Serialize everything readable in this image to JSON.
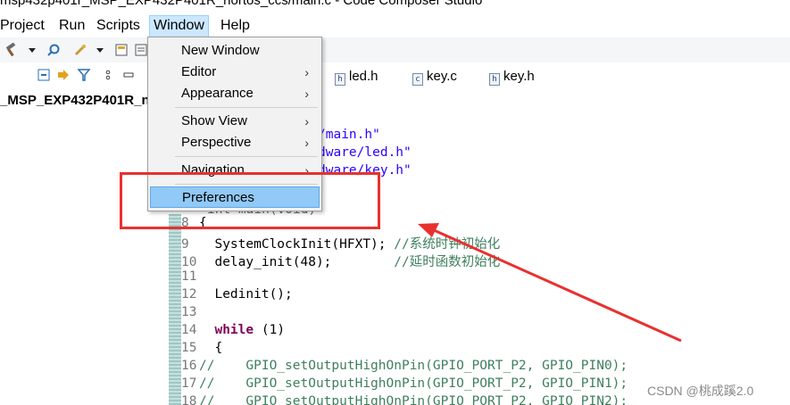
{
  "window": {
    "title": "msp432p401r_MSP_EXP432P401R_nortos_ccs/main.c - Code Composer Studio"
  },
  "menubar": {
    "items": [
      "Project",
      "Run",
      "Scripts",
      "Window",
      "Help"
    ],
    "active": "Window"
  },
  "window_menu": {
    "items": [
      {
        "label": "New Window",
        "submenu": false
      },
      {
        "label": "Editor",
        "submenu": true
      },
      {
        "label": "Appearance",
        "submenu": true
      },
      {
        "label": "Show View",
        "submenu": true
      },
      {
        "label": "Perspective",
        "submenu": true
      },
      {
        "label": "Navigation",
        "submenu": true
      },
      {
        "label": "Preferences",
        "submenu": false,
        "highlighted": true
      }
    ],
    "arrow_glyph": "›"
  },
  "editor_tabs": [
    {
      "label": "led.h",
      "icon": "h-file-icon",
      "glyph": "h"
    },
    {
      "label": "key.c",
      "icon": "c-file-icon",
      "glyph": "c"
    },
    {
      "label": "key.h",
      "icon": "h-file-icon",
      "glyph": "h"
    }
  ],
  "project_explorer": {
    "label": "_MSP_EXP432P401R_n"
  },
  "code": {
    "includes": [
      "/main.h\"",
      "dware/led.h\"",
      "dware/key.h\""
    ],
    "lines": [
      {
        "n": "8",
        "text": "{"
      },
      {
        "n": "9",
        "text": "  SystemClockInit(HFXT); ",
        "comment": "//系统时钟初始化"
      },
      {
        "n": "10",
        "text": "  delay_init(48);        ",
        "comment": "//延时函数初始化"
      },
      {
        "n": "11",
        "text": ""
      },
      {
        "n": "12",
        "text": "  Ledinit();"
      },
      {
        "n": "13",
        "text": ""
      },
      {
        "n": "14",
        "text": "  ",
        "keyword": "while",
        "after": " (1)"
      },
      {
        "n": "15",
        "text": "  {"
      },
      {
        "n": "16",
        "comment": "//    GPIO_setOutputHighOnPin(GPIO_PORT_P2, GPIO_PIN0);"
      },
      {
        "n": "17",
        "comment": "//    GPIO_setOutputHighOnPin(GPIO_PORT_P2, GPIO_PIN1);"
      },
      {
        "n": "18",
        "comment": "//    GPIO_setOutputHighOnPin(GPIO_PORT_P2, GPIO_PIN2);"
      }
    ]
  },
  "watermark": "CSDN @桃成蹊2.0",
  "colors": {
    "annotation_red": "#e8312f",
    "menu_highlight": "#91c9f7",
    "keyword": "#7f0055",
    "string": "#2a00ff",
    "comment": "#3f7f5f"
  },
  "icons": {
    "toolbar": [
      "hammer-icon",
      "dropdown-icon",
      "search-icon",
      "wand-icon",
      "dropdown-icon",
      "save-all-icon",
      "copy-icon"
    ],
    "viewbar": [
      "collapse-all-icon",
      "link-editor-icon",
      "filter-icon",
      "menu-dots-icon",
      "minimize-icon"
    ]
  }
}
